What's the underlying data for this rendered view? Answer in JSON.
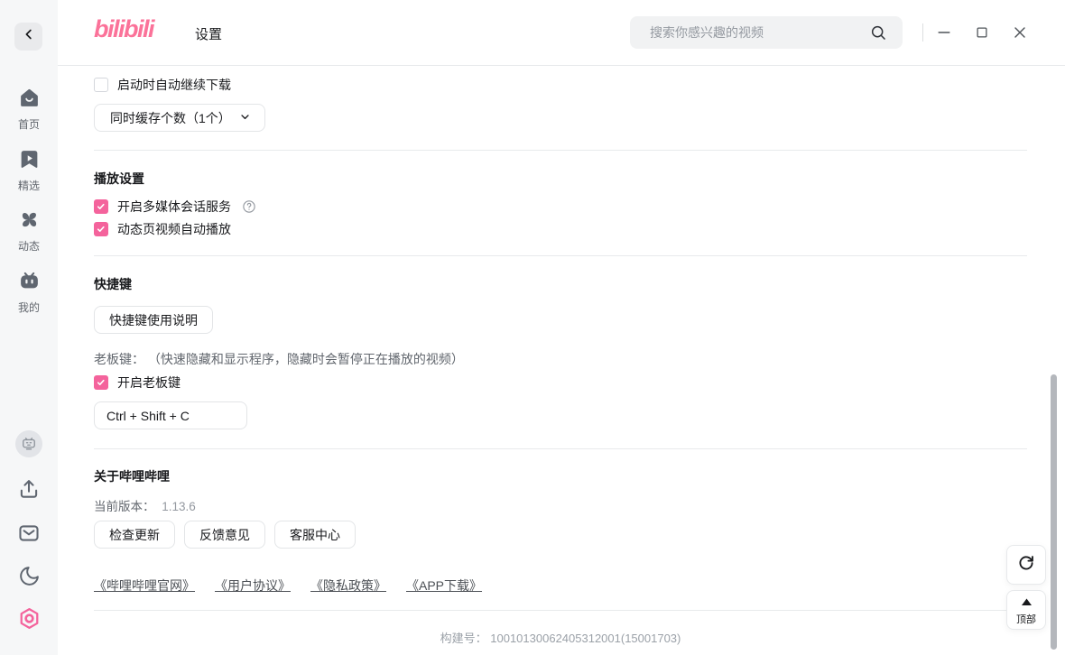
{
  "colors": {
    "brand_pink": "#fb7299",
    "checkbox_pink": "#f4639c",
    "text_primary": "#18191c",
    "text_secondary": "#61666d",
    "text_muted": "#9499a0",
    "border": "#e7e9eb",
    "sidebar_bg": "#f6f7f8",
    "search_bg": "#f1f2f3"
  },
  "header": {
    "logo_text": "bilibili",
    "page_title": "设置",
    "search_placeholder": "搜索你感兴趣的视频",
    "icons": [
      "back-icon",
      "magnifier-icon",
      "minimize-icon",
      "maximize-icon",
      "close-icon"
    ]
  },
  "sidebar": {
    "nav": [
      {
        "label": "首页",
        "icon": "home-icon"
      },
      {
        "label": "精选",
        "icon": "featured-icon"
      },
      {
        "label": "动态",
        "icon": "dynamic-icon"
      },
      {
        "label": "我的",
        "icon": "mine-icon"
      }
    ],
    "tools": [
      {
        "icon": "avatar-tv-icon"
      },
      {
        "icon": "upload-icon"
      },
      {
        "icon": "mail-icon"
      },
      {
        "icon": "moon-icon"
      },
      {
        "icon": "record-icon"
      }
    ]
  },
  "settings": {
    "download": {
      "resume_label": "启动时自动继续下载",
      "resume_checked": false,
      "cache_dropdown_label": "同时缓存个数（1个）"
    },
    "playback": {
      "heading": "播放设置",
      "items": [
        {
          "label": "开启多媒体会话服务",
          "checked": true,
          "help_icon": true
        },
        {
          "label": "动态页视频自动播放",
          "checked": true
        }
      ]
    },
    "shortcuts": {
      "heading": "快捷键",
      "usage_button": "快捷键使用说明",
      "boss_key_label": "老板键： （快速隐藏和显示程序，隐藏时会暂停正在播放的视频）",
      "enable_label": "开启老板键",
      "enable_checked": true,
      "key_value": "Ctrl + Shift + C"
    },
    "about": {
      "heading": "关于哔哩哔哩",
      "version_label": "当前版本：",
      "version_value": "1.13.6",
      "buttons": [
        "检查更新",
        "反馈意见",
        "客服中心"
      ],
      "links": [
        "《哔哩哔哩官网》",
        "《用户协议》",
        "《隐私政策》",
        "《APP下载》"
      ],
      "build_label": "构建号：",
      "build_value": "10010130062405312001(15001703)"
    }
  },
  "floating": {
    "refresh_icon": "refresh-icon",
    "back_to_top": {
      "icon": "triangle-up-icon",
      "label": "顶部"
    }
  }
}
